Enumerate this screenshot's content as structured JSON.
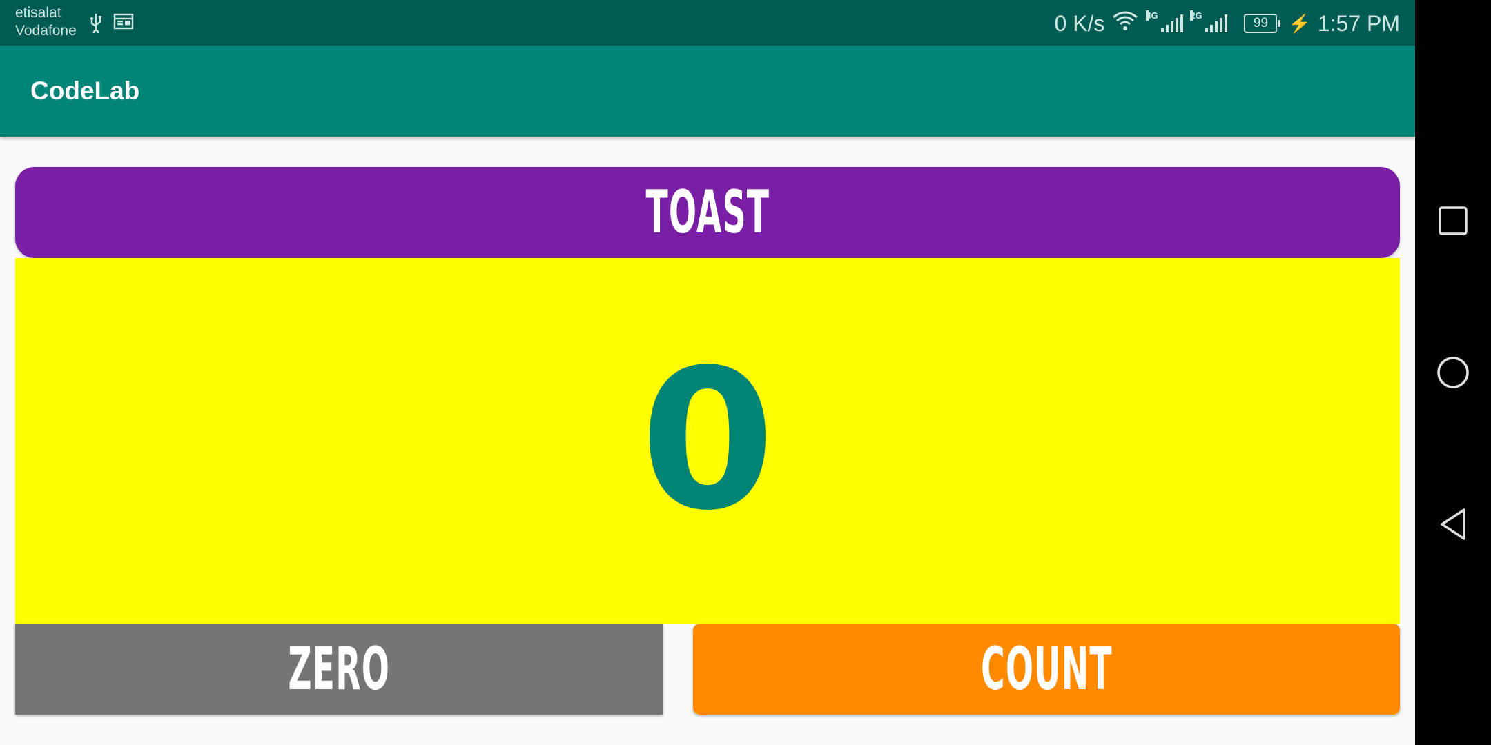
{
  "status_bar": {
    "carrier_1": "etisalat",
    "carrier_2": "Vodafone",
    "net_speed": "0 K/s",
    "network_1": "4G",
    "network_2": "2G",
    "battery": "99",
    "time": "1:57 PM",
    "icons": [
      "usb-icon",
      "calendar-icon",
      "wifi-icon",
      "signal-icon",
      "battery-icon",
      "charging-icon"
    ]
  },
  "app_bar": {
    "title": "CodeLab"
  },
  "main": {
    "toast_label": "TOAST",
    "count_value": "0",
    "zero_label": "ZERO",
    "count_label": "COUNT"
  },
  "colors": {
    "status_bar": "#005b52",
    "app_bar": "#028577",
    "toast_button": "#7a1fa5",
    "count_panel": "#ffff00",
    "count_text": "#028577",
    "zero_button": "#757575",
    "count_button": "#ff8a00",
    "nav_bar": "#000000"
  },
  "nav_bar": {
    "icons": [
      "recents-square-icon",
      "home-circle-icon",
      "back-triangle-icon"
    ]
  }
}
